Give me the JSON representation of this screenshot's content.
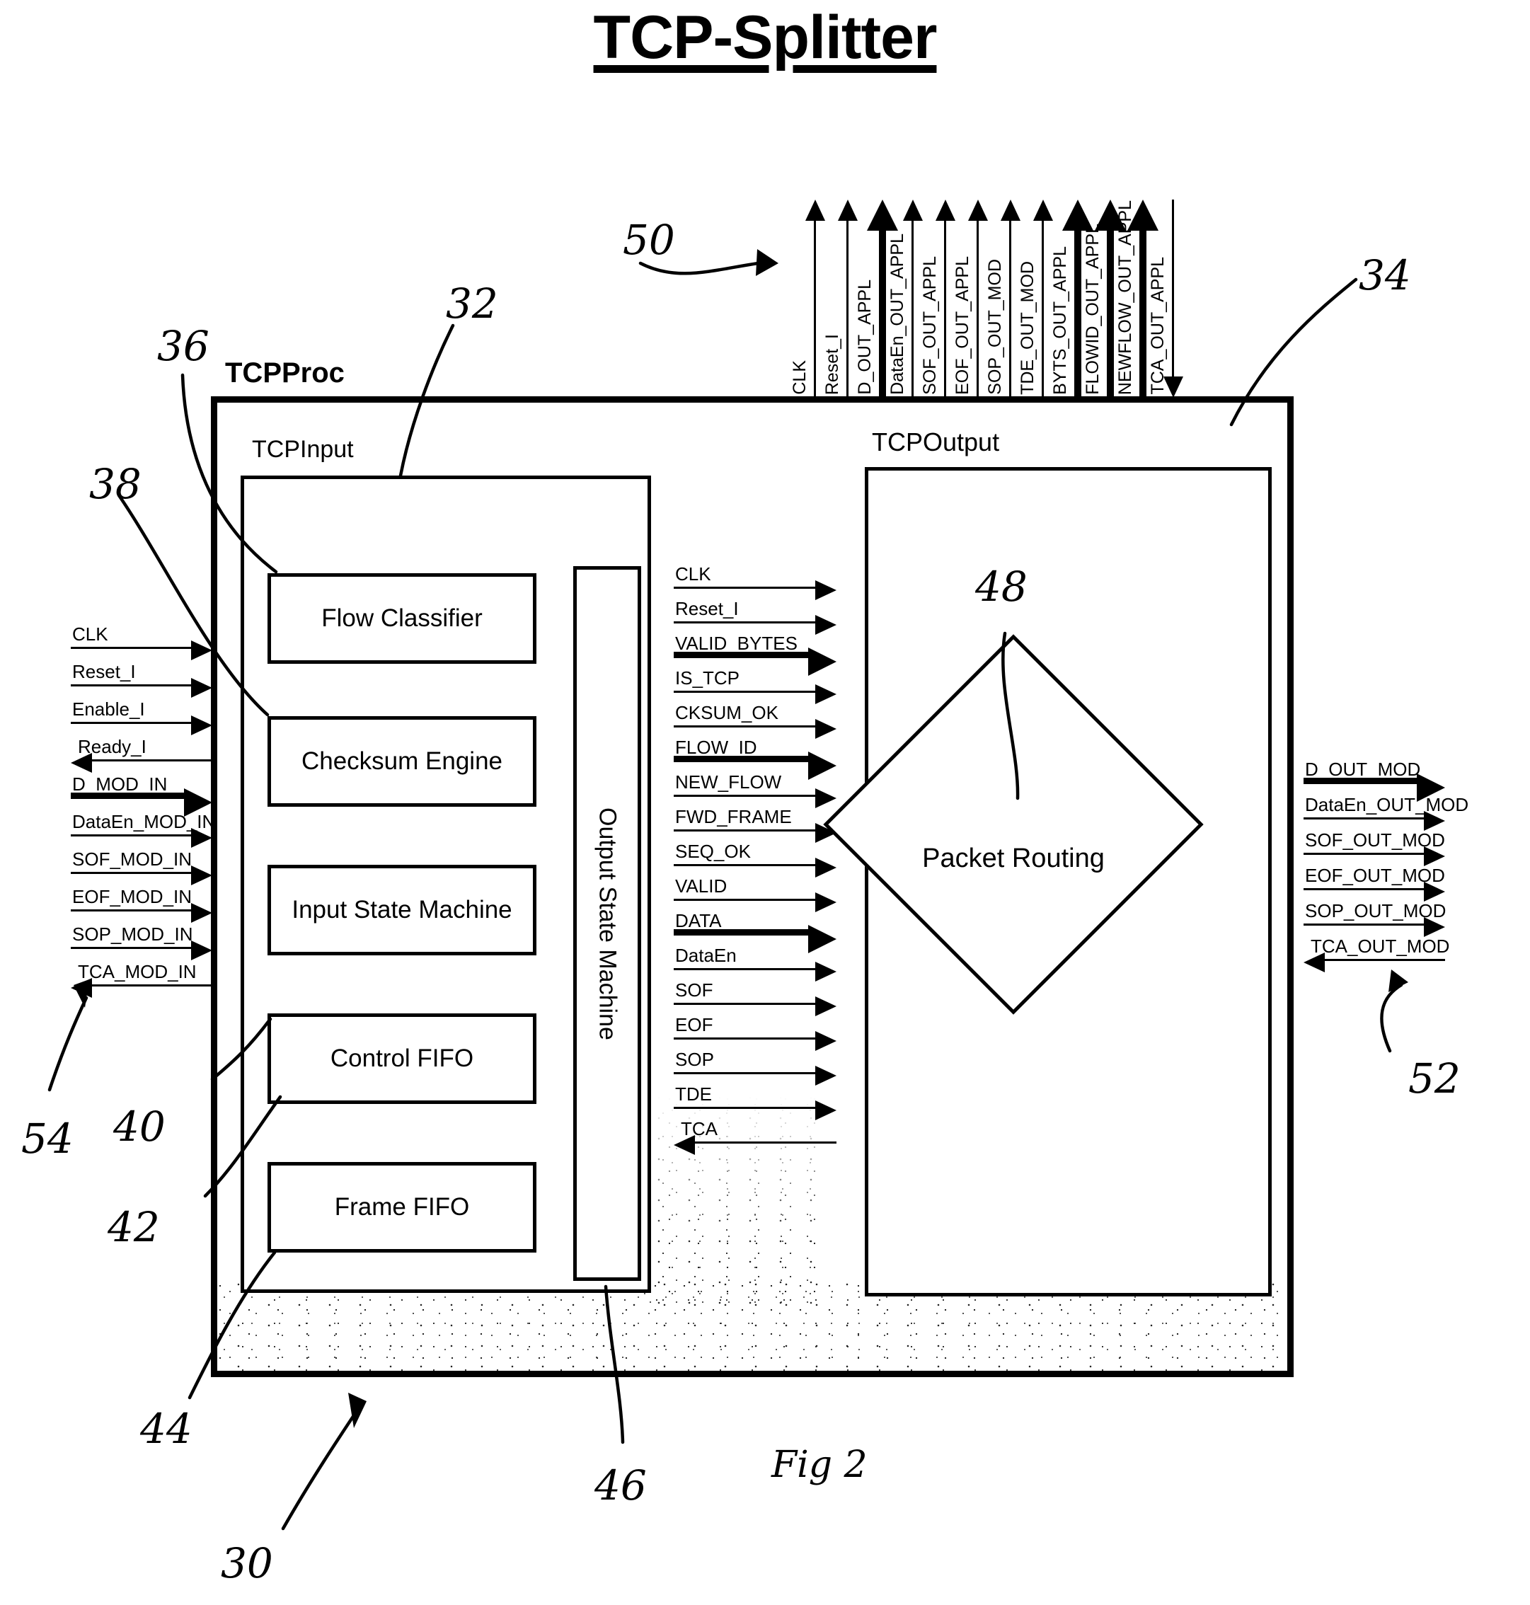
{
  "title": "TCP-Splitter",
  "blocks": {
    "tcpproc": "TCPProc",
    "tcpinput": "TCPInput",
    "tcpoutput": "TCPOutput",
    "flow_classifier": "Flow Classifier",
    "checksum_engine": "Checksum Engine",
    "input_state_machine": "Input State Machine",
    "control_fifo": "Control FIFO",
    "frame_fifo": "Frame FIFO",
    "output_state_machine": "Output State Machine",
    "packet_routing": "Packet Routing"
  },
  "top_signals": [
    {
      "label": "CLK",
      "dir": "up",
      "width": "thin"
    },
    {
      "label": "Reset_I",
      "dir": "up",
      "width": "thin"
    },
    {
      "label": "D_OUT_APPL",
      "dir": "up",
      "width": "thick"
    },
    {
      "label": "DataEn_OUT_APPL",
      "dir": "up",
      "width": "thin"
    },
    {
      "label": "SOF_OUT_APPL",
      "dir": "up",
      "width": "thin"
    },
    {
      "label": "EOF_OUT_APPL",
      "dir": "up",
      "width": "thin"
    },
    {
      "label": "SOP_OUT_MOD",
      "dir": "up",
      "width": "thin"
    },
    {
      "label": "TDE_OUT_MOD",
      "dir": "up",
      "width": "thin"
    },
    {
      "label": "BYTS_OUT_APPL",
      "dir": "up",
      "width": "thick"
    },
    {
      "label": "FLOWID_OUT_APPL",
      "dir": "up",
      "width": "thick"
    },
    {
      "label": "NEWFLOW_OUT_APPL",
      "dir": "up",
      "width": "thick"
    },
    {
      "label": "TCA_OUT_APPL",
      "dir": "down",
      "width": "thin"
    }
  ],
  "left_signals": [
    {
      "label": "CLK",
      "dir": "right",
      "width": "thin"
    },
    {
      "label": "Reset_I",
      "dir": "right",
      "width": "thin"
    },
    {
      "label": "Enable_I",
      "dir": "right",
      "width": "thin"
    },
    {
      "label": "Ready_I",
      "dir": "left",
      "width": "thin"
    },
    {
      "label": "D_MOD_IN",
      "dir": "right",
      "width": "thick"
    },
    {
      "label": "DataEn_MOD_IN",
      "dir": "right",
      "width": "thin"
    },
    {
      "label": "SOF_MOD_IN",
      "dir": "right",
      "width": "thin"
    },
    {
      "label": "EOF_MOD_IN",
      "dir": "right",
      "width": "thin"
    },
    {
      "label": "SOP_MOD_IN",
      "dir": "right",
      "width": "thin"
    },
    {
      "label": "TCA_MOD_IN",
      "dir": "left",
      "width": "thin"
    }
  ],
  "middle_signals": [
    {
      "label": "CLK",
      "dir": "right",
      "width": "thin"
    },
    {
      "label": "Reset_I",
      "dir": "right",
      "width": "thin"
    },
    {
      "label": "VALID_BYTES",
      "dir": "right",
      "width": "thick"
    },
    {
      "label": "IS_TCP",
      "dir": "right",
      "width": "thin"
    },
    {
      "label": "CKSUM_OK",
      "dir": "right",
      "width": "thin"
    },
    {
      "label": "FLOW_ID",
      "dir": "right",
      "width": "thick"
    },
    {
      "label": "NEW_FLOW",
      "dir": "right",
      "width": "thin"
    },
    {
      "label": "FWD_FRAME",
      "dir": "right",
      "width": "thin"
    },
    {
      "label": "SEQ_OK",
      "dir": "right",
      "width": "thin"
    },
    {
      "label": "VALID",
      "dir": "right",
      "width": "thin"
    },
    {
      "label": "DATA",
      "dir": "right",
      "width": "thick"
    },
    {
      "label": "DataEn",
      "dir": "right",
      "width": "thin"
    },
    {
      "label": "SOF",
      "dir": "right",
      "width": "thin"
    },
    {
      "label": "EOF",
      "dir": "right",
      "width": "thin"
    },
    {
      "label": "SOP",
      "dir": "right",
      "width": "thin"
    },
    {
      "label": "TDE",
      "dir": "right",
      "width": "thin"
    },
    {
      "label": "TCA",
      "dir": "left",
      "width": "thin"
    }
  ],
  "right_signals": [
    {
      "label": "D_OUT_MOD",
      "dir": "right",
      "width": "thick"
    },
    {
      "label": "DataEn_OUT_MOD",
      "dir": "right",
      "width": "thin"
    },
    {
      "label": "SOF_OUT_MOD",
      "dir": "right",
      "width": "thin"
    },
    {
      "label": "EOF_OUT_MOD",
      "dir": "right",
      "width": "thin"
    },
    {
      "label": "SOP_OUT_MOD",
      "dir": "right",
      "width": "thin"
    },
    {
      "label": "TCA_OUT_MOD",
      "dir": "left",
      "width": "thin"
    }
  ],
  "callouts": {
    "n30": "30",
    "n32": "32",
    "n34": "34",
    "n36": "36",
    "n38": "38",
    "n40": "40",
    "n42": "42",
    "n44": "44",
    "n46": "46",
    "n48": "48",
    "n50": "50",
    "n52": "52",
    "n54": "54",
    "fig": "Fig 2"
  }
}
